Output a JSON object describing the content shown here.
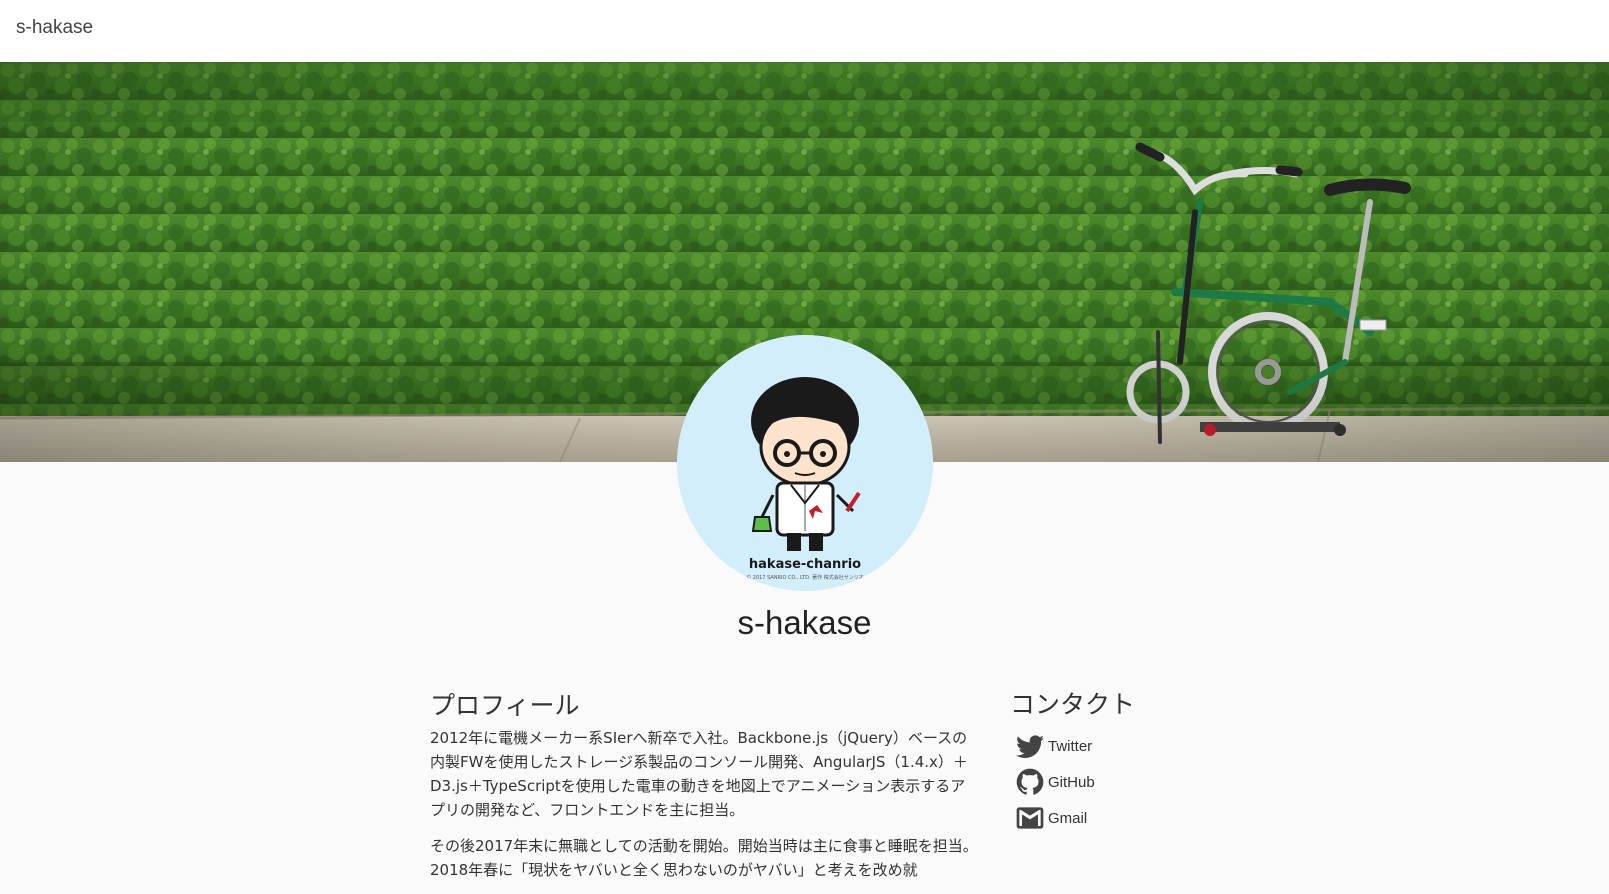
{
  "header": {
    "site_title": "s-hakase"
  },
  "avatar": {
    "caption": "hakase-chanrio",
    "fine_print": "© 2017 SANRIO CO., LTD. 著作 株式会社サンリオ"
  },
  "profile": {
    "name": "s-hakase",
    "section_title": "プロフィール",
    "paragraphs": [
      "2012年に電機メーカー系SIerへ新卒で入社。Backbone.js（jQuery）ベースの内製FWを使用したストレージ系製品のコンソール開発、AngularJS（1.4.x）＋D3.js＋TypeScriptを使用した電車の動きを地図上でアニメーション表示するアプリの開発など、フロントエンドを主に担当。",
      "その後2017年末に無職としての活動を開始。開始当時は主に食事と睡眠を担当。2018年春に「現状をヤバいと全く思わないのがヤバい」と考えを改め就"
    ]
  },
  "contact": {
    "section_title": "コンタクト",
    "items": [
      {
        "label": "Twitter",
        "icon": "twitter-icon"
      },
      {
        "label": "GitHub",
        "icon": "github-icon"
      },
      {
        "label": "Gmail",
        "icon": "gmail-icon"
      }
    ]
  },
  "colors": {
    "page_background": "#fafafa",
    "header_background": "#ffffff",
    "avatar_background": "#d2eefb",
    "hedge_green": "#3f7a26",
    "bicycle_green": "#1d7a45",
    "text": "#333333"
  }
}
